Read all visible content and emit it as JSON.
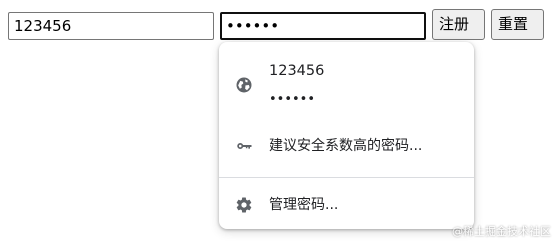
{
  "form": {
    "username_value": "123456",
    "password_value": "••••••",
    "register_label": "注册",
    "reset_label": "重置"
  },
  "autofill": {
    "saved_entry": {
      "username": "123456",
      "password_mask": "••••••",
      "icon": "globe-icon"
    },
    "suggest": {
      "label": "建议安全系数高的密码...",
      "icon": "key-icon"
    },
    "manage": {
      "label": "管理密码...",
      "icon": "gear-icon"
    }
  },
  "watermark": "@稀土掘金技术社区",
  "colors": {
    "icon": "#5f6368",
    "text": "#202124",
    "divider": "#dadce0"
  }
}
